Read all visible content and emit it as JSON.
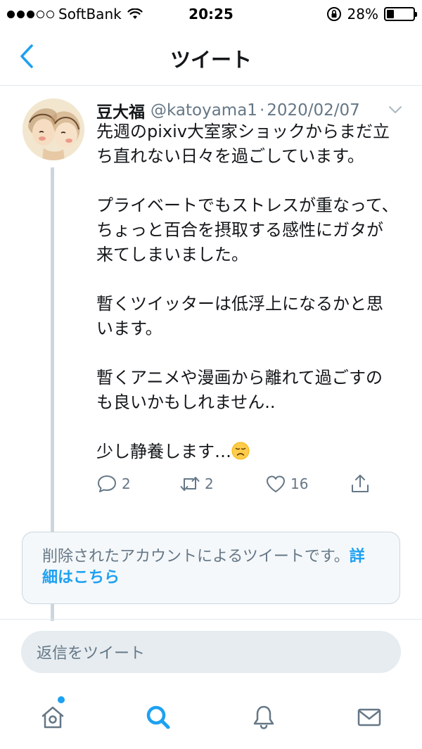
{
  "status_bar": {
    "carrier": "SoftBank",
    "time": "20:25",
    "battery_text": "28%",
    "battery_level": 0.28
  },
  "header": {
    "title": "ツイート"
  },
  "tweet": {
    "author_name": "豆大福",
    "author_handle": "@katoyama1",
    "separator": "·",
    "date": "2020/02/07",
    "paragraphs": [
      "先週のpixiv大室家ショックからまだ立ち直れない日々を過ごしています。",
      "プライベートでもストレスが重なって、ちょっと百合を摂取する感性にガタが来てしまいました。",
      "暫くツイッターは低浮上になるかと思います。",
      "暫くアニメや漫画から離れて過ごすのも良いかもしれません..",
      "少し静養します…"
    ],
    "final_emoji": "disappointed-face",
    "actions": {
      "reply_count": "2",
      "retweet_count": "2",
      "like_count": "16"
    }
  },
  "deleted_notice": {
    "text": "削除されたアカウントによるツイートです。",
    "link_label": "詳細はこちら"
  },
  "reply": {
    "placeholder": "返信をツイート"
  },
  "tab_bar": {
    "items": [
      "home-icon",
      "search-icon",
      "bell-icon",
      "mail-icon"
    ],
    "active": "search",
    "accent": "#1da1f2"
  },
  "colors": {
    "accent": "#1da1f2",
    "secondary_text": "#657786",
    "primary_text": "#14171a",
    "divider": "#e1e8ed"
  }
}
